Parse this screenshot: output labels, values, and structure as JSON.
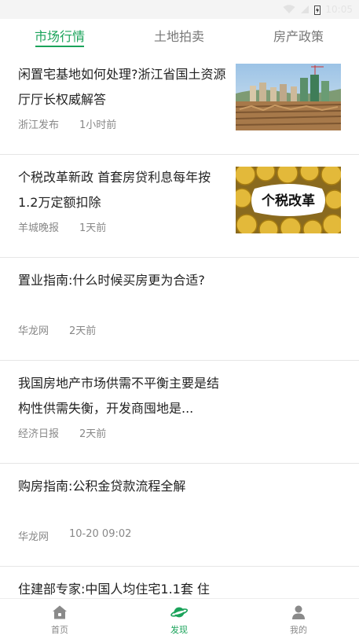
{
  "status_bar": {
    "time": "10:05"
  },
  "tabs": [
    {
      "label": "市场行情",
      "active": true
    },
    {
      "label": "土地拍卖",
      "active": false
    },
    {
      "label": "房产政策",
      "active": false
    }
  ],
  "news": [
    {
      "title": "闲置宅基地如何处理?浙江省国土资源厅厅长权威解答",
      "source": "浙江发布",
      "time": "1小时前",
      "has_image": true
    },
    {
      "title": "个税改革新政 首套房贷利息每年按1.2万定额扣除",
      "source": "羊城晚报",
      "time": "1天前",
      "has_image": true,
      "image_caption": "个税改革"
    },
    {
      "title": "置业指南:什么时候买房更为合适?",
      "source": "华龙网",
      "time": "2天前",
      "has_image": false
    },
    {
      "title": "我国房地产市场供需不平衡主要是结构性供需失衡，开发商囤地是...",
      "source": "经济日报",
      "time": "2天前",
      "has_image": false
    },
    {
      "title": "购房指南:公积金贷款流程全解",
      "source": "华龙网",
      "time": "10-20 09:02",
      "has_image": false
    },
    {
      "title": "住建部专家:中国人均住宅1.1套 住",
      "source": "",
      "time": "",
      "has_image": false
    }
  ],
  "bottom_nav": [
    {
      "label": "首页",
      "icon": "home-icon",
      "active": false
    },
    {
      "label": "发现",
      "icon": "planet-icon",
      "active": true
    },
    {
      "label": "我的",
      "icon": "user-icon",
      "active": false
    }
  ],
  "colors": {
    "accent": "#1aa35a",
    "muted": "#888888",
    "divider": "#e6e6e6"
  }
}
